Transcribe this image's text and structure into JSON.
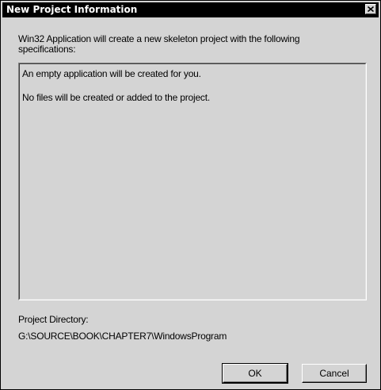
{
  "window": {
    "title": "New Project Information",
    "close_icon": "close-icon"
  },
  "intro": {
    "text": "Win32 Application will create a new skeleton project with the following specifications:"
  },
  "info": {
    "lines": [
      "An empty application will be created for you.",
      "No files will be created or added to the project."
    ]
  },
  "project_directory": {
    "label": "Project Directory:",
    "value": "G:\\SOURCE\\BOOK\\CHAPTER7\\WindowsProgram"
  },
  "buttons": {
    "ok": "OK",
    "cancel": "Cancel"
  },
  "colors": {
    "title_bar": "#000000",
    "dialog_face": "#d4d4d4"
  }
}
